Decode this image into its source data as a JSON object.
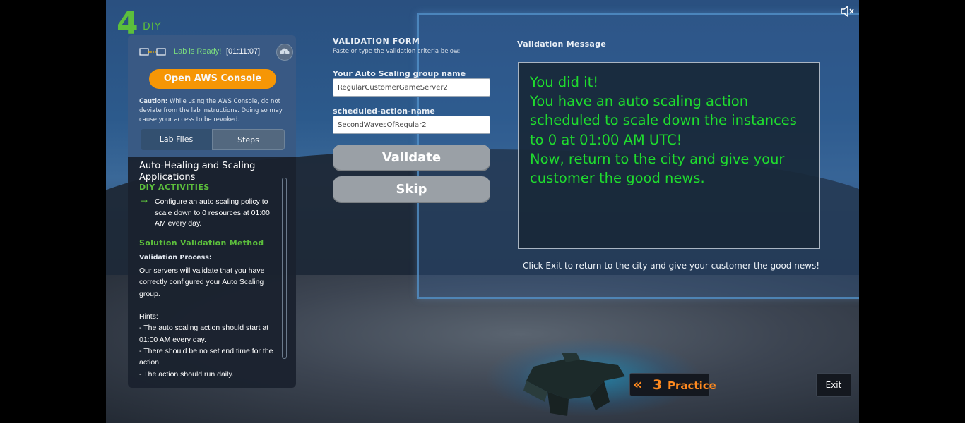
{
  "logo": {
    "number": "4",
    "label": "DIY"
  },
  "status": {
    "lab_ready": "Lab is Ready!",
    "timer": "[01:11:07]"
  },
  "aws_console_button": "Open AWS Console",
  "caution": {
    "label": "Caution:",
    "text": " While using the AWS Console, do not deviate from the lab instructions. Doing so may cause your access to be revoked."
  },
  "tabs": [
    {
      "label": "Lab Files"
    },
    {
      "label": "Steps"
    }
  ],
  "steps": {
    "title": "Auto-Healing and Scaling Applications",
    "activities_heading": "DIY ACTIVITIES",
    "activity_arrow": "→",
    "activity": "Configure an auto scaling policy to scale down to 0 resources at 01:00 AM every day.",
    "solution_heading": "Solution Validation Method",
    "process_label": "Validation Process:",
    "process_text": "Our servers will validate that you have correctly configured your Auto Scaling group.\n\nHints:\n- The auto scaling action should start at 01:00 AM every day.\n- There should be no set end time for the action.\n- The action should run daily."
  },
  "form": {
    "title": "VALIDATION FORM",
    "subtitle": "Paste or type the validation criteria below:",
    "fields": [
      {
        "label": "Your Auto Scaling group name",
        "value": "RegularCustomerGameServer2"
      },
      {
        "label": "scheduled-action-name",
        "value": "SecondWavesOfRegular2"
      }
    ],
    "validate_button": "Validate",
    "skip_button": "Skip"
  },
  "validation_message": {
    "title": "Validation Message",
    "text": "You did it!\nYou have an auto scaling action scheduled to scale down the instances to 0 at 01:00 AM UTC!\nNow, return to the city and give your customer the good news.",
    "color": "#1fdc2e"
  },
  "exit_note": "Click Exit to return to the city and give your customer the good news!",
  "practice": {
    "chevron": "«",
    "number": "3",
    "label": "Practice",
    "color": "#ff8a1f"
  },
  "exit_button": "Exit",
  "icons": [
    "connection-icon",
    "cloud-icon",
    "arrow-right-icon",
    "mute-icon",
    "double-chevron-left-icon"
  ]
}
